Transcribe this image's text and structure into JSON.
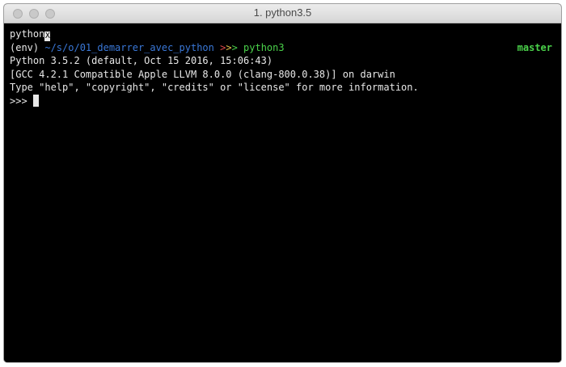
{
  "window": {
    "title": "1. python3.5"
  },
  "terminal": {
    "lines": [
      {
        "text": "python",
        "cursor_char": "X"
      },
      {
        "prefix": "(env) ",
        "path": "~/s/o/01_demarrer_avec_python",
        "arrows": [
          ">",
          ">",
          ">"
        ],
        "command": " python3",
        "branch": "master"
      },
      {
        "text": "Python 3.5.2 (default, Oct 15 2016, 15:06:43)"
      },
      {
        "text": "[GCC 4.2.1 Compatible Apple LLVM 8.0.0 (clang-800.0.38)] on darwin"
      },
      {
        "text": "Type \"help\", \"copyright\", \"credits\" or \"license\" for more information."
      },
      {
        "prompt": ">>> "
      }
    ]
  },
  "colors": {
    "background": "#000000",
    "text": "#e8e8e8",
    "path": "#3a78d8",
    "arrow_red": "#e24a4a",
    "arrow_yellow": "#e5c34a",
    "arrow_green": "#4ad14a",
    "branch": "#4ad14a"
  }
}
